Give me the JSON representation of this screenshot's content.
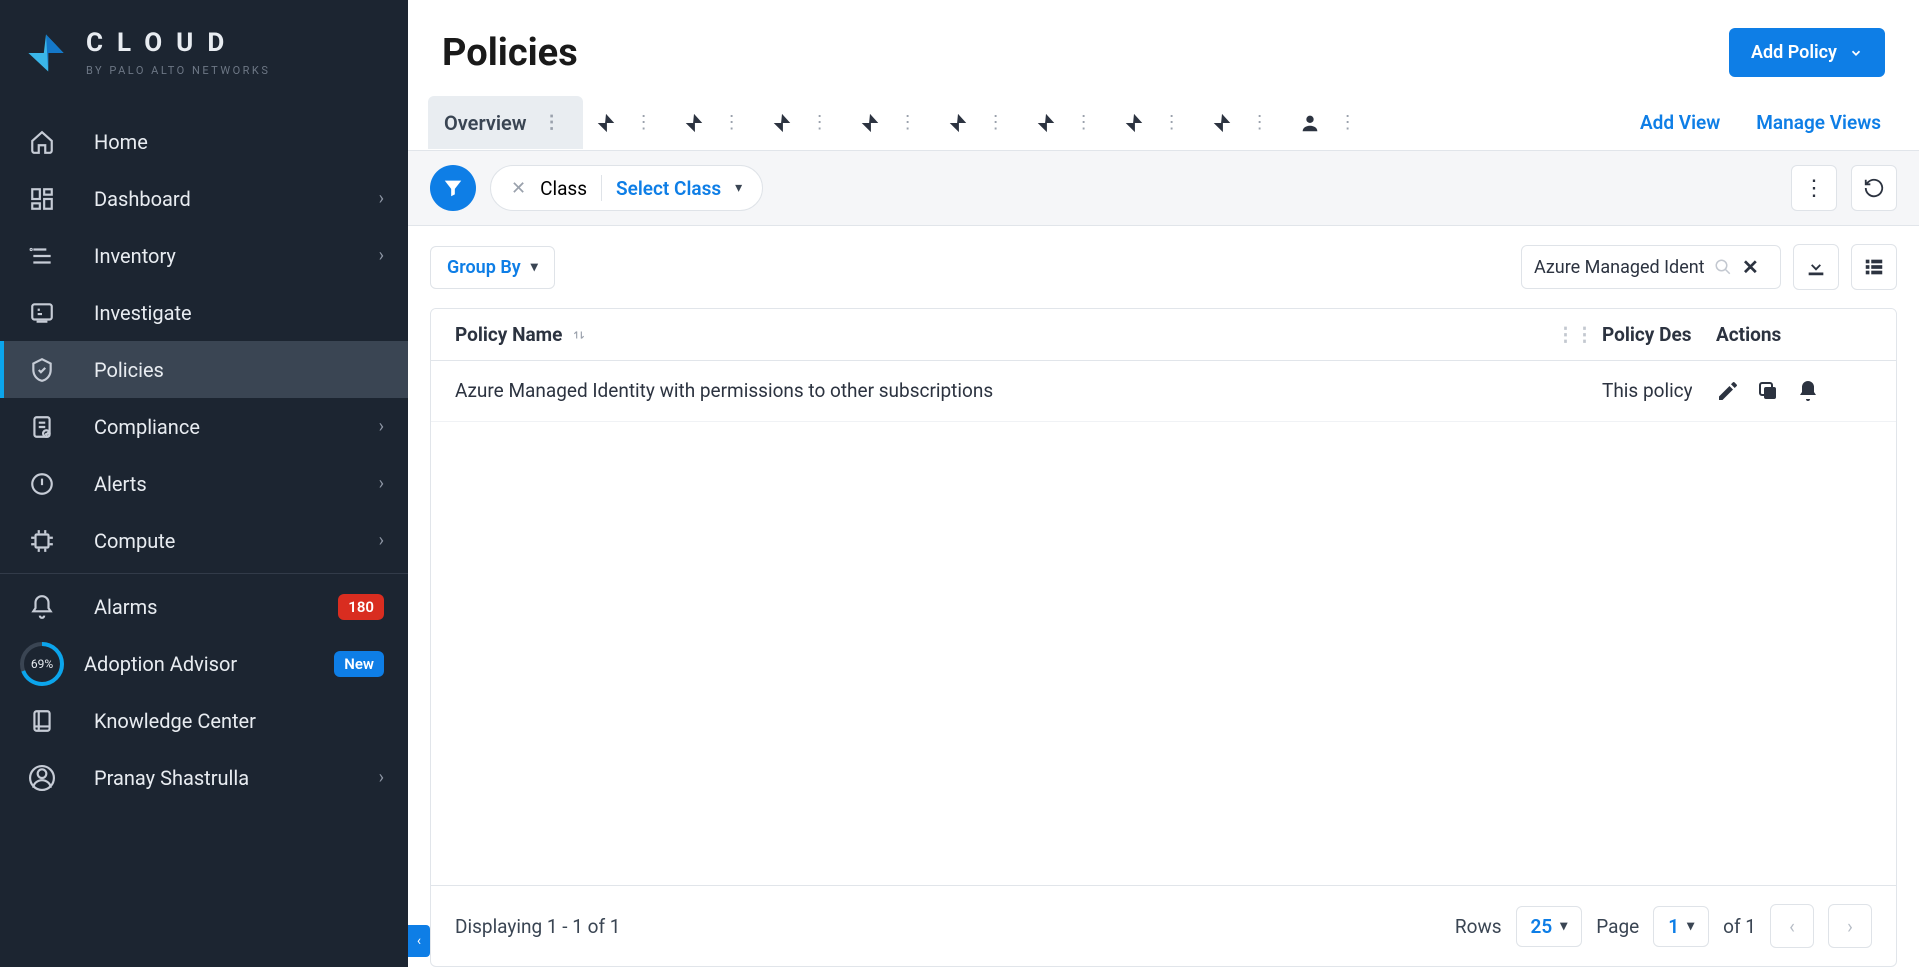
{
  "brand": {
    "title": "CLOUD",
    "subtitle": "BY PALO ALTO NETWORKS"
  },
  "sidebar": {
    "items": [
      {
        "label": "Home",
        "expandable": false
      },
      {
        "label": "Dashboard",
        "expandable": true
      },
      {
        "label": "Inventory",
        "expandable": true
      },
      {
        "label": "Investigate",
        "expandable": false
      },
      {
        "label": "Policies",
        "expandable": false,
        "active": true
      },
      {
        "label": "Compliance",
        "expandable": true
      },
      {
        "label": "Alerts",
        "expandable": true
      },
      {
        "label": "Compute",
        "expandable": true
      }
    ],
    "lower": [
      {
        "label": "Alarms",
        "badge": "180",
        "badge_kind": "alert"
      },
      {
        "label": "Adoption Advisor",
        "badge": "New",
        "badge_kind": "new",
        "ring": "69%"
      },
      {
        "label": "Knowledge Center"
      },
      {
        "label": "Pranay Shastrulla",
        "expandable": true
      }
    ]
  },
  "header": {
    "title": "Policies",
    "add_button": "Add Policy"
  },
  "tabs": {
    "overview": "Overview",
    "add_view": "Add View",
    "manage_views": "Manage Views"
  },
  "filter": {
    "chip_label": "Class",
    "chip_action": "Select Class"
  },
  "toolbar": {
    "group_by": "Group By",
    "search_value": "Azure Managed Identity w"
  },
  "table": {
    "col_name": "Policy Name",
    "col_desc": "Policy Des",
    "col_actions": "Actions",
    "rows": [
      {
        "name": "Azure Managed Identity with permissions to other subscriptions",
        "desc": "This policy"
      }
    ]
  },
  "footer": {
    "displaying": "Displaying 1 - 1 of 1",
    "rows_label": "Rows",
    "rows_value": "25",
    "page_label": "Page",
    "page_value": "1",
    "page_of": "of 1"
  }
}
